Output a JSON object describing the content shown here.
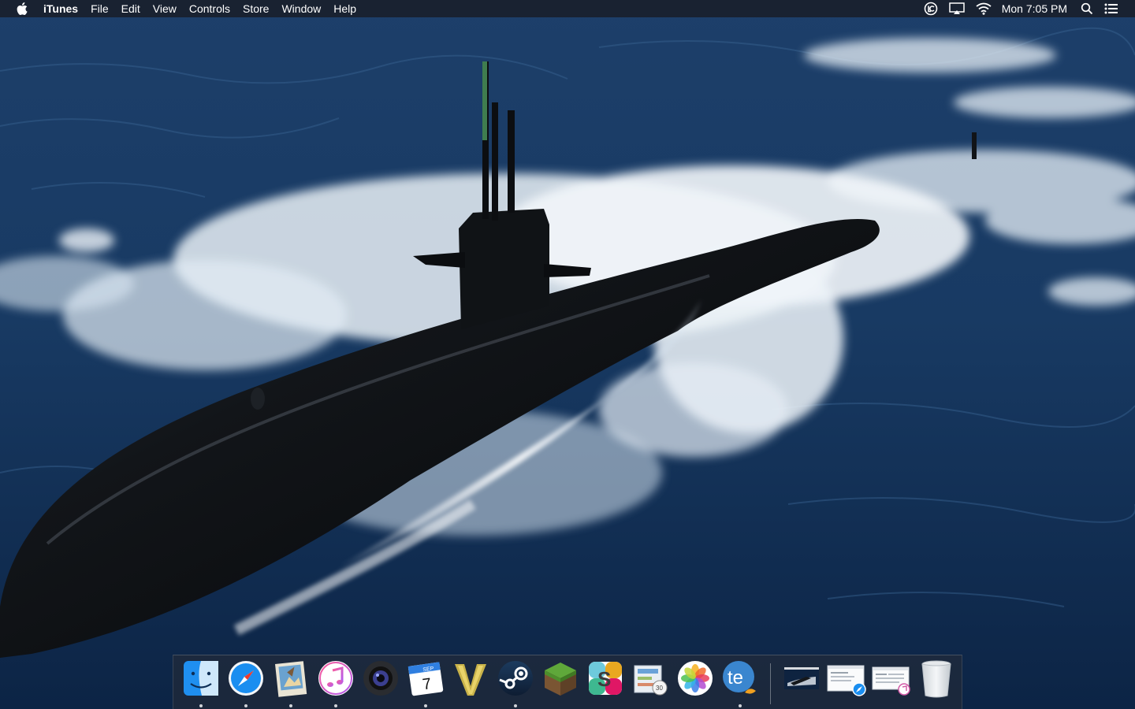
{
  "menubar": {
    "app_name": "iTunes",
    "menus": [
      "File",
      "Edit",
      "View",
      "Controls",
      "Store",
      "Window",
      "Help"
    ],
    "clock": "Mon 7:05 PM",
    "status_icons": [
      "logmein-icon",
      "airplay-icon",
      "wifi-icon",
      "spotlight-icon",
      "notification-center-icon"
    ]
  },
  "colors": {
    "menubar_bg": "#1a1d24",
    "ocean_deep": "#0f2a4e",
    "foam": "#f2f6fa",
    "hull": "#0d0f12"
  },
  "dock": {
    "apps": [
      {
        "name": "Finder",
        "icon": "finder-icon",
        "running": true
      },
      {
        "name": "Safari",
        "icon": "safari-icon",
        "running": true
      },
      {
        "name": "Preview",
        "icon": "preview-icon",
        "running": true
      },
      {
        "name": "iTunes",
        "icon": "itunes-icon",
        "running": true
      },
      {
        "name": "Photo Booth",
        "icon": "camera-icon",
        "running": false
      },
      {
        "name": "Calendar",
        "icon": "calendar-icon",
        "running": true,
        "month": "SEP",
        "day": "7"
      },
      {
        "name": "Vectorize",
        "icon": "vee-icon",
        "running": false
      },
      {
        "name": "Steam",
        "icon": "steam-icon",
        "running": true
      },
      {
        "name": "Minecraft",
        "icon": "minecraft-icon",
        "running": false
      },
      {
        "name": "Slack",
        "icon": "slack-icon",
        "running": false
      },
      {
        "name": "Screenshot Planner",
        "icon": "planner-icon",
        "running": false
      },
      {
        "name": "Photos",
        "icon": "photos-icon",
        "running": false
      },
      {
        "name": "TextExpander",
        "icon": "textexpander-icon",
        "running": true,
        "label": "te"
      }
    ],
    "minimized": [
      {
        "name": "Wallpaper window",
        "icon": "minimized-window-icon"
      },
      {
        "name": "Safari window",
        "icon": "minimized-safari-window-icon"
      },
      {
        "name": "iTunes window",
        "icon": "minimized-itunes-window-icon"
      }
    ],
    "trash": {
      "name": "Trash",
      "icon": "trash-icon"
    }
  }
}
